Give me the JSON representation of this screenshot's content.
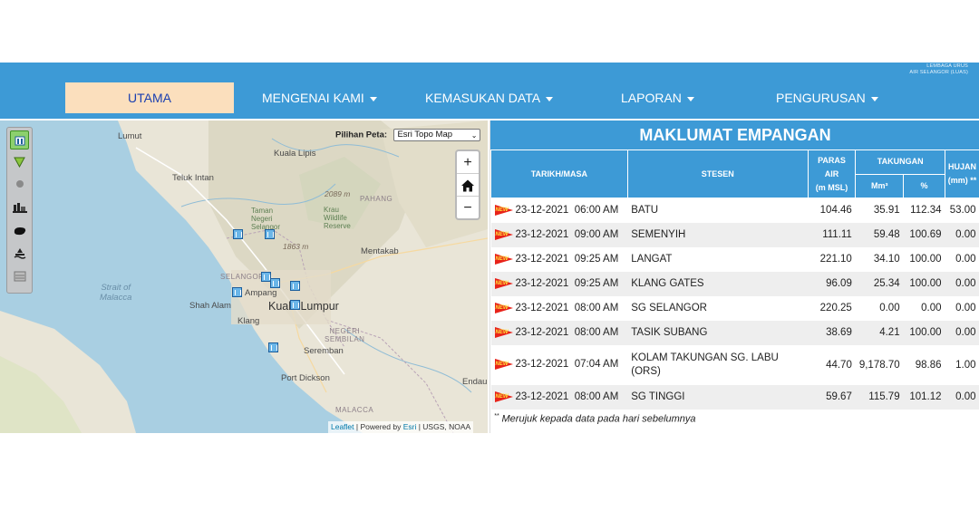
{
  "org": {
    "line1": "LEMBAGA URUS",
    "line2": "AIR SELANGOR (LUAS)"
  },
  "nav": {
    "items": [
      {
        "label": "UTAMA",
        "active": true
      },
      {
        "label": "MENGENAI KAMI",
        "dropdown": true
      },
      {
        "label": "KEMASUKAN DATA",
        "dropdown": true
      },
      {
        "label": "LAPORAN",
        "dropdown": true
      },
      {
        "label": "PENGURUSAN",
        "dropdown": true
      }
    ]
  },
  "map": {
    "basemap_label": "Pilihan Peta:",
    "basemap_selected": "Esri Topo Map",
    "zoom_in": "+",
    "zoom_out": "−",
    "attribution": {
      "leaflet": "Leaflet",
      "powered": " | Powered by ",
      "esri": "Esri",
      "sources": " | USGS, NOAA"
    },
    "labels": {
      "lumut": "Lumut",
      "kuala_lipis": "Kuala Lipis",
      "teluk_intan": "Teluk Intan",
      "pahang": "PAHANG",
      "elev_2089": "2089 m",
      "taman_negara": "Taman\nNegeri\nSelangor",
      "krau": "Krau\nWildlife\nReserve",
      "elev_1863": "1863 m",
      "mentakab": "Mentakab",
      "strait": "Strait of\nMalacca",
      "selangor": "SELANGOR",
      "ampang": "Ampang",
      "shah_alam": "Shah Alam",
      "kuala_lumpur": "Kuala Lumpur",
      "klang": "Klang",
      "negeri": "NEGERI\nSEMBILAN",
      "seremban": "Seremban",
      "port_dickson": "Port Dickson",
      "malacca": "MALACCA",
      "endau": "Endau"
    }
  },
  "panel": {
    "title": "MAKLUMAT EMPANGAN",
    "headers": {
      "tarikh": "TARIKH/MASA",
      "stesen": "STESEN",
      "paras": "PARAS\nAIR\n(m MSL)",
      "takungan": "TAKUNGAN",
      "mm3": "Mm³",
      "percent": "%",
      "hujan": "HUJAN\n(mm) **"
    },
    "badge_text": "NEW",
    "rows": [
      {
        "date": "23-12-2021",
        "time": "06:00 AM",
        "station": "BATU",
        "paras": "104.46",
        "mm3": "35.91",
        "pct": "112.34",
        "hujan": "53.00"
      },
      {
        "date": "23-12-2021",
        "time": "09:00 AM",
        "station": "SEMENYIH",
        "paras": "111.11",
        "mm3": "59.48",
        "pct": "100.69",
        "hujan": "0.00"
      },
      {
        "date": "23-12-2021",
        "time": "09:25 AM",
        "station": "LANGAT",
        "paras": "221.10",
        "mm3": "34.10",
        "pct": "100.00",
        "hujan": "0.00"
      },
      {
        "date": "23-12-2021",
        "time": "09:25 AM",
        "station": "KLANG GATES",
        "paras": "96.09",
        "mm3": "25.34",
        "pct": "100.00",
        "hujan": "0.00"
      },
      {
        "date": "23-12-2021",
        "time": "08:00 AM",
        "station": "SG SELANGOR",
        "paras": "220.25",
        "mm3": "0.00",
        "pct": "0.00",
        "hujan": "0.00"
      },
      {
        "date": "23-12-2021",
        "time": "08:00 AM",
        "station": "TASIK SUBANG",
        "paras": "38.69",
        "mm3": "4.21",
        "pct": "100.00",
        "hujan": "0.00"
      },
      {
        "date": "23-12-2021",
        "time": "07:04 AM",
        "station": "KOLAM TAKUNGAN SG. LABU\n(ORS)",
        "paras": "44.70",
        "mm3": "9,178.70",
        "pct": "98.86",
        "hujan": "1.00"
      },
      {
        "date": "23-12-2021",
        "time": "08:00 AM",
        "station": "SG TINGGI",
        "paras": "59.67",
        "mm3": "115.79",
        "pct": "101.12",
        "hujan": "0.00"
      }
    ],
    "footnote_mark": "**",
    "footnote": " Merujuk kepada data pada hari sebelumnya"
  },
  "colors": {
    "header_blue": "#3d9ad6",
    "active_tab": "#fbdfbd",
    "badge_red": "#e8231a"
  }
}
